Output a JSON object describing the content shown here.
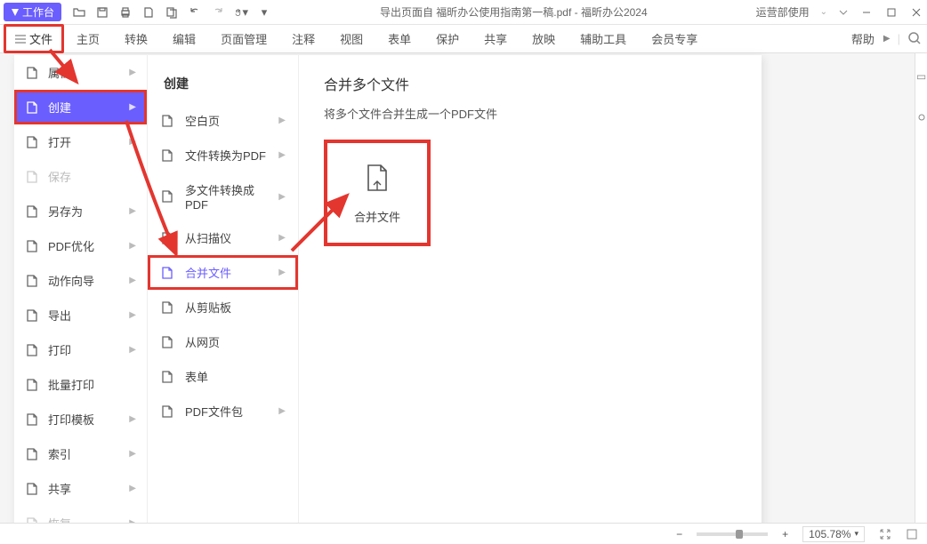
{
  "titlebar": {
    "workspace": "工作台",
    "doc_title": "导出页面自 福昕办公使用指南第一稿.pdf - 福昕办公2024",
    "user_area": "运营部使用"
  },
  "tabs": {
    "file": "文件",
    "home": "主页",
    "convert": "转换",
    "edit": "编辑",
    "page": "页面管理",
    "annotate": "注释",
    "view": "视图",
    "form": "表单",
    "protect": "保护",
    "share": "共享",
    "play": "放映",
    "tools": "辅助工具",
    "vip": "会员专享",
    "help": "帮助"
  },
  "file_menu": [
    {
      "label": "属性",
      "icon": "info-icon",
      "has_sub": true
    },
    {
      "label": "创建",
      "icon": "create-icon",
      "has_sub": true,
      "selected": true
    },
    {
      "label": "打开",
      "icon": "open-icon",
      "has_sub": true
    },
    {
      "label": "保存",
      "icon": "save-icon",
      "has_sub": false,
      "disabled": true
    },
    {
      "label": "另存为",
      "icon": "saveas-icon",
      "has_sub": true
    },
    {
      "label": "PDF优化",
      "icon": "optimize-icon",
      "has_sub": true
    },
    {
      "label": "动作向导",
      "icon": "action-icon",
      "has_sub": true
    },
    {
      "label": "导出",
      "icon": "export-icon",
      "has_sub": true
    },
    {
      "label": "打印",
      "icon": "print-icon",
      "has_sub": true
    },
    {
      "label": "批量打印",
      "icon": "batch-print-icon",
      "has_sub": false
    },
    {
      "label": "打印模板",
      "icon": "print-template-icon",
      "has_sub": true
    },
    {
      "label": "索引",
      "icon": "index-icon",
      "has_sub": true
    },
    {
      "label": "共享",
      "icon": "share-icon",
      "has_sub": true
    },
    {
      "label": "恢复",
      "icon": "restore-icon",
      "has_sub": true,
      "disabled": true
    }
  ],
  "submenu": {
    "heading": "创建",
    "items": [
      {
        "label": "空白页",
        "icon": "blank-page-icon",
        "has_sub": true
      },
      {
        "label": "文件转换为PDF",
        "icon": "file-to-pdf-icon",
        "has_sub": true
      },
      {
        "label": "多文件转换成PDF",
        "icon": "multi-to-pdf-icon",
        "has_sub": true
      },
      {
        "label": "从扫描仪",
        "icon": "scanner-icon",
        "has_sub": true
      },
      {
        "label": "合并文件",
        "icon": "merge-icon",
        "has_sub": true,
        "highlighted": true
      },
      {
        "label": "从剪贴板",
        "icon": "clipboard-icon",
        "has_sub": false
      },
      {
        "label": "从网页",
        "icon": "web-icon",
        "has_sub": false
      },
      {
        "label": "表单",
        "icon": "form-icon",
        "has_sub": false
      },
      {
        "label": "PDF文件包",
        "icon": "portfolio-icon",
        "has_sub": true
      }
    ]
  },
  "detail": {
    "title": "合并多个文件",
    "desc": "将多个文件合并生成一个PDF文件",
    "tile_label": "合并文件"
  },
  "statusbar": {
    "zoom": "105.78%"
  }
}
